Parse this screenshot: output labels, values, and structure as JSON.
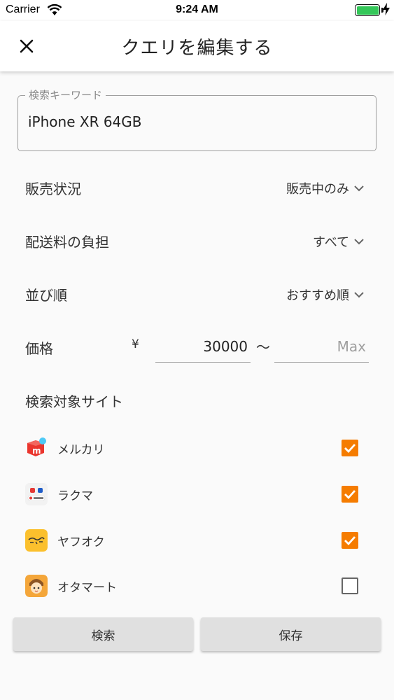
{
  "status_bar": {
    "carrier": "Carrier",
    "time": "9:24 AM"
  },
  "header": {
    "title": "クエリを編集する",
    "close_icon": "close-icon"
  },
  "keyword": {
    "label": "検索キーワード",
    "value": "iPhone XR 64GB"
  },
  "filters": {
    "sale_status": {
      "label": "販売状況",
      "value": "販売中のみ"
    },
    "shipping": {
      "label": "配送料の負担",
      "value": "すべて"
    },
    "sort": {
      "label": "並び順",
      "value": "おすすめ順"
    }
  },
  "price": {
    "label": "価格",
    "currency": "¥",
    "min_value": "30000",
    "separator": "〜",
    "max_placeholder": "Max"
  },
  "sites": {
    "label": "検索対象サイト",
    "items": [
      {
        "name": "メルカリ",
        "checked": true,
        "icon": "mercari-icon"
      },
      {
        "name": "ラクマ",
        "checked": true,
        "icon": "rakuma-icon"
      },
      {
        "name": "ヤフオク",
        "checked": true,
        "icon": "yafuoku-icon"
      },
      {
        "name": "オタマート",
        "checked": false,
        "icon": "otamart-icon"
      }
    ]
  },
  "buttons": {
    "search": "検索",
    "save": "保存"
  },
  "colors": {
    "accent": "#f57c00",
    "button_bg": "#e0e0e0",
    "battery": "#34c759"
  }
}
